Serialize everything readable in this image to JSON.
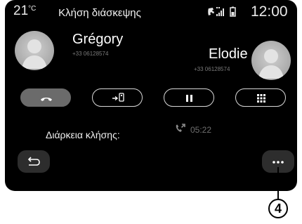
{
  "status_bar": {
    "temperature": "21",
    "temperature_unit": "°C",
    "title": "Κλήση διάσκεψης",
    "clock": "12:00",
    "icons": [
      "phone-signal-icon",
      "signal-bars-icon",
      "battery-icon"
    ]
  },
  "callers": [
    {
      "name": "Grégory",
      "number": "+33 06128574",
      "avatar_icon": "person-avatar-icon"
    },
    {
      "name": "Elodie",
      "number": "+33 06128574",
      "avatar_icon": "person-avatar-icon"
    }
  ],
  "controls": [
    {
      "name": "hang-up-button",
      "icon": "hang-up-icon"
    },
    {
      "name": "transfer-audio-button",
      "icon": "phone-transfer-icon"
    },
    {
      "name": "pause-button",
      "icon": "pause-icon"
    },
    {
      "name": "keypad-button",
      "icon": "keypad-grid-icon"
    }
  ],
  "call_duration": {
    "label": "Διάρκεια κλήσης:",
    "value": "05:22",
    "icon": "call-duration-icon"
  },
  "back_button": {
    "icon": "back-arrow-icon"
  },
  "more_button": {
    "icon": "more-dots-icon"
  },
  "callout": {
    "number": "4"
  }
}
